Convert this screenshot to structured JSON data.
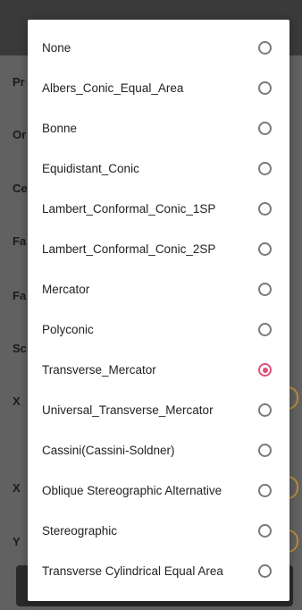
{
  "background_labels": [
    "Pr",
    "Or",
    "Ce",
    "Fa",
    "Fa",
    "Sc",
    "X",
    "X",
    "Y"
  ],
  "projection_dialog": {
    "selected_index": 8,
    "accent_color": "#e04f7a",
    "options": [
      "None",
      "Albers_Conic_Equal_Area",
      "Bonne",
      "Equidistant_Conic",
      "Lambert_Conformal_Conic_1SP",
      "Lambert_Conformal_Conic_2SP",
      "Mercator",
      "Polyconic",
      "Transverse_Mercator",
      "Universal_Transverse_Mercator",
      "Cassini(Cassini-Soldner)",
      "Oblique Stereographic Alternative",
      "Stereographic",
      "Transverse Cylindrical Equal Area"
    ]
  }
}
